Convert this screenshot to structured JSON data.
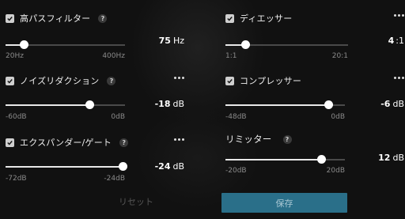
{
  "sections": [
    {
      "key": "highpass",
      "title": "高パスフィルター",
      "checked": true,
      "help": "?",
      "more": false,
      "value": "75",
      "unit": "Hz",
      "min": "20Hz",
      "max": "400Hz",
      "level": 0.15
    },
    {
      "key": "deesser",
      "title": "ディエッサー",
      "checked": true,
      "help": "?",
      "more": true,
      "value": "4",
      "unit": ":1",
      "min": "1:1",
      "max": "20:1",
      "level": 0.16
    },
    {
      "key": "noise",
      "title": "ノイズリダクション",
      "checked": true,
      "help": "?",
      "more": true,
      "value": "-18",
      "unit": "dB",
      "min": "-60dB",
      "max": "0dB",
      "level": 0.7
    },
    {
      "key": "compressor",
      "title": "コンプレッサー",
      "checked": true,
      "help": "?",
      "more": true,
      "value": "-6",
      "unit": "dB",
      "min": "-48dB",
      "max": "0dB",
      "level": 0.86
    },
    {
      "key": "expander",
      "title": "エクスパンダー/ゲート",
      "checked": true,
      "help": "?",
      "more": true,
      "value": "-24",
      "unit": "dB",
      "min": "-72dB",
      "max": "-24dB",
      "level": 1.0
    },
    {
      "key": "limiter",
      "title": "リミッター",
      "checked": false,
      "help": "?",
      "more": false,
      "value": "12",
      "unit": "dB",
      "min": "-20dB",
      "max": "20dB",
      "level": 0.8
    }
  ],
  "buttons": {
    "reset": "リセット",
    "save": "保存"
  }
}
